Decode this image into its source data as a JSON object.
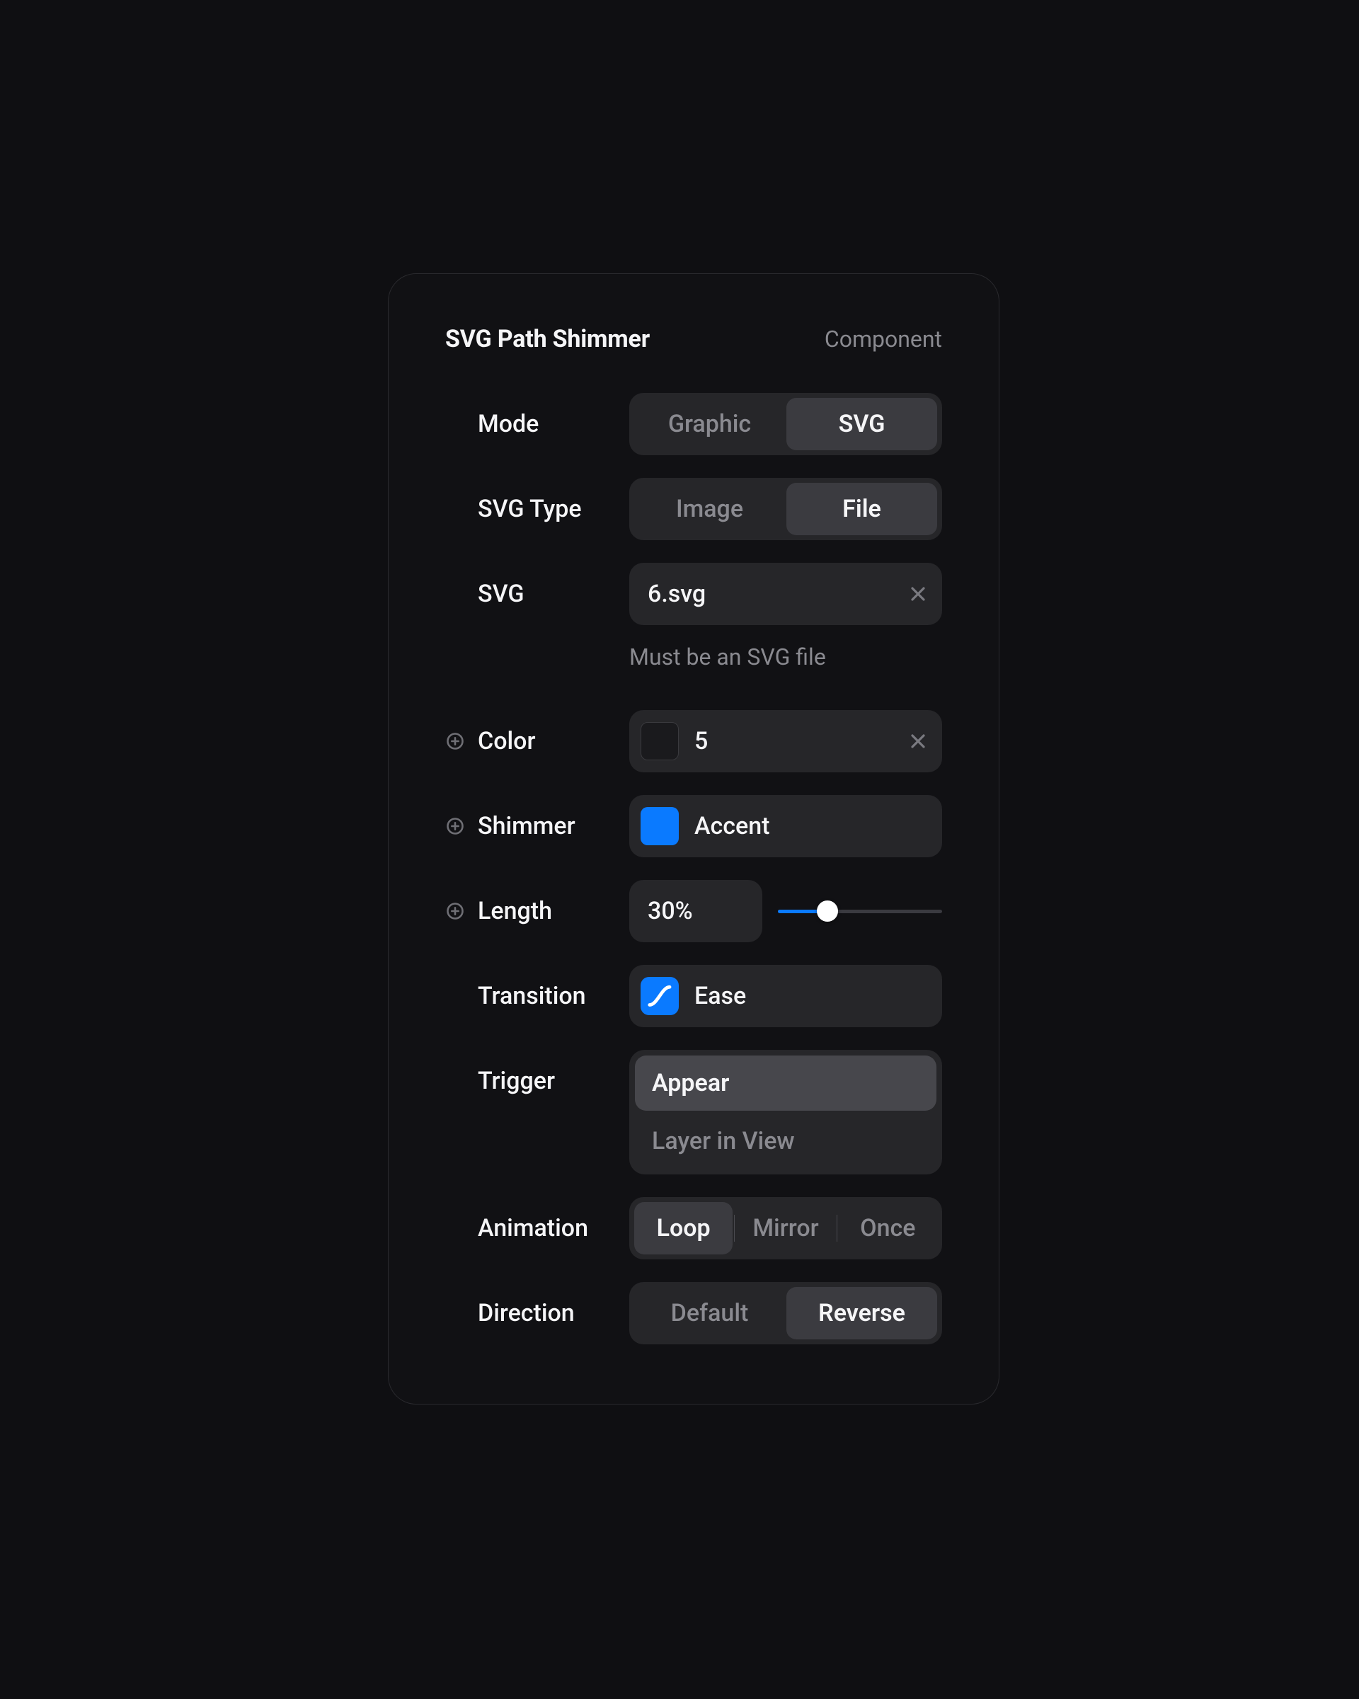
{
  "header": {
    "title": "SVG Path Shimmer",
    "type": "Component"
  },
  "labels": {
    "mode": "Mode",
    "svg_type": "SVG Type",
    "svg": "SVG",
    "color": "Color",
    "shimmer": "Shimmer",
    "length": "Length",
    "transition": "Transition",
    "trigger": "Trigger",
    "animation": "Animation",
    "direction": "Direction"
  },
  "mode": {
    "options": [
      "Graphic",
      "SVG"
    ],
    "selected": "SVG"
  },
  "svg_type": {
    "options": [
      "Image",
      "File"
    ],
    "selected": "File"
  },
  "svg_file": {
    "value": "6.svg",
    "helper": "Must be an SVG file"
  },
  "color": {
    "value": "5",
    "swatch": "#1a1a1d"
  },
  "shimmer": {
    "label": "Accent",
    "swatch": "#0a7aff"
  },
  "length": {
    "value": "30%",
    "percent": 30
  },
  "transition": {
    "label": "Ease"
  },
  "trigger": {
    "options": [
      "Appear",
      "Layer in View"
    ],
    "selected": "Appear"
  },
  "animation": {
    "options": [
      "Loop",
      "Mirror",
      "Once"
    ],
    "selected": "Loop"
  },
  "direction": {
    "options": [
      "Default",
      "Reverse"
    ],
    "selected": "Reverse"
  }
}
